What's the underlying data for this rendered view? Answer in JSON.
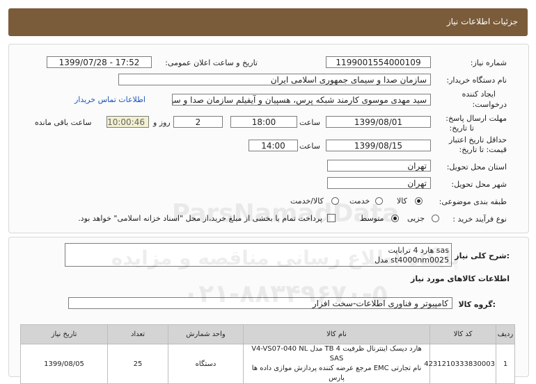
{
  "header": {
    "title": "جزئیات اطلاعات نیاز"
  },
  "fields": {
    "need_number_label": "شماره نیاز:",
    "need_number": "1199001554000109",
    "announce_label": "تاریخ و ساعت اعلان عمومی:",
    "announce_value": "1399/07/28 - 17:52",
    "buyer_label": "نام دستگاه خریدار:",
    "buyer_value": "سازمان صدا و سیمای جمهوری اسلامی ایران",
    "requester_label_1": "ایجاد کننده",
    "requester_label_2": "درخواست:",
    "requester_value": "سید مهدی موسوی کارمند شبکه پرس، هسپیان و آیفیلم سازمان صدا و سیمای",
    "contact_link": "اطلاعات تماس خریدار",
    "deadline_label_1": "مهلت ارسال پاسخ:",
    "deadline_label_2": "تا تاریخ:",
    "deadline_date": "1399/08/01",
    "time_label": "ساعت",
    "deadline_time": "18:00",
    "days_value": "2",
    "days_label": "روز و",
    "remaining_value": "10:00:46",
    "remaining_label": "ساعت باقی مانده",
    "validity_label_1": "حداقل تاریخ اعتبار",
    "validity_label_2": "قیمت: تا تاریخ:",
    "validity_date": "1399/08/15",
    "validity_time": "14:00",
    "province_label": "استان محل تحویل:",
    "province_value": "تهران",
    "city_label": "شهر محل تحویل:",
    "city_value": "تهران",
    "category_label": "طبقه بندی موضوعی:",
    "category_options": [
      "کالا",
      "خدمت",
      "کالا/خدمت"
    ],
    "category_selected": "کالا",
    "process_label": "نوع فرآیند خرید :",
    "process_options": [
      "جزیی",
      "متوسط"
    ],
    "process_selected": "متوسط",
    "payment_note": "پرداخت تمام یا بخشی از مبلغ خرید،از محل \"اسناد خزانه اسلامی\" خواهد بود."
  },
  "description": {
    "label": "شرح کلی نیاز:",
    "line1": "هارد 4 ترابایت sas",
    "line2": "مدل st4000nm0025"
  },
  "goods": {
    "section_title": "اطلاعات کالاهای مورد نیاز",
    "group_label": "گروه کالا:",
    "group_value": "کامپیوتر و فناوری اطلاعات-سخت افزار"
  },
  "table": {
    "headers": [
      "ردیف",
      "کد کالا",
      "نام کالا",
      "واحد شمارش",
      "تعداد",
      "تاریخ نیاز"
    ],
    "rows": [
      {
        "index": "1",
        "code": "4231210333830003",
        "name_1": "هارد دیسک اینترنال ظرفیت 4 TB مدل V4-VS07-040 NL SAS",
        "name_2": "نام تجارتی EMC مرجع عرضه کننده پردازش موازی داده ها",
        "name_3": "پارس",
        "unit": "دستگاه",
        "qty": "25",
        "date": "1399/08/05"
      }
    ]
  },
  "watermark": {
    "line1": "ParsNamadData",
    "line2": "پایگاه اطلاع رسانی مناقصه و مزایده",
    "line3": "۰۲۱-۸۸۳۴۹۶۷۰-۵"
  },
  "colors": {
    "header_bg": "#7a5b3a",
    "remaining_bg": "#f2f0cf",
    "link": "#1c56b8"
  }
}
